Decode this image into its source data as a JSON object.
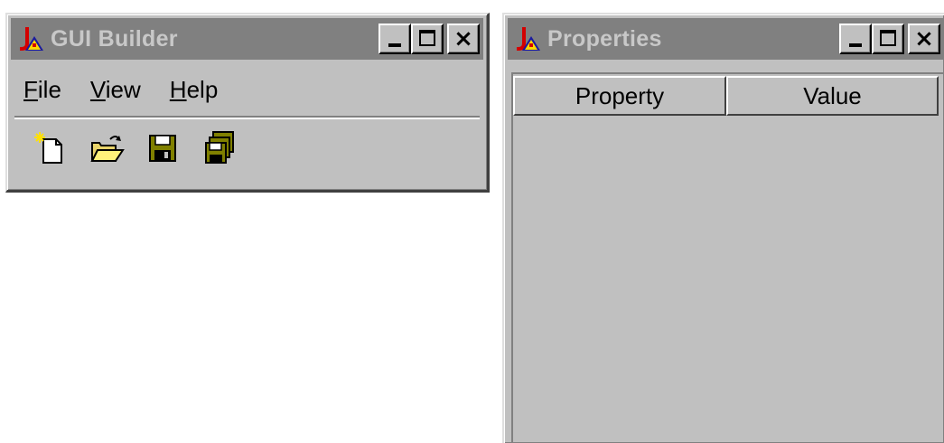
{
  "builder_window": {
    "title": "GUI Builder",
    "menu": [
      {
        "mnemonic": "F",
        "rest": "ile"
      },
      {
        "mnemonic": "V",
        "rest": "iew"
      },
      {
        "mnemonic": "H",
        "rest": "elp"
      }
    ],
    "toolbar": [
      {
        "icon": "new-file-icon"
      },
      {
        "icon": "open-folder-icon"
      },
      {
        "icon": "save-icon"
      },
      {
        "icon": "save-all-icon"
      }
    ]
  },
  "properties_window": {
    "title": "Properties",
    "columns": [
      "Property",
      "Value"
    ]
  },
  "colors": {
    "titlebar_inactive": "#808080",
    "face": "#c0c0c0"
  }
}
